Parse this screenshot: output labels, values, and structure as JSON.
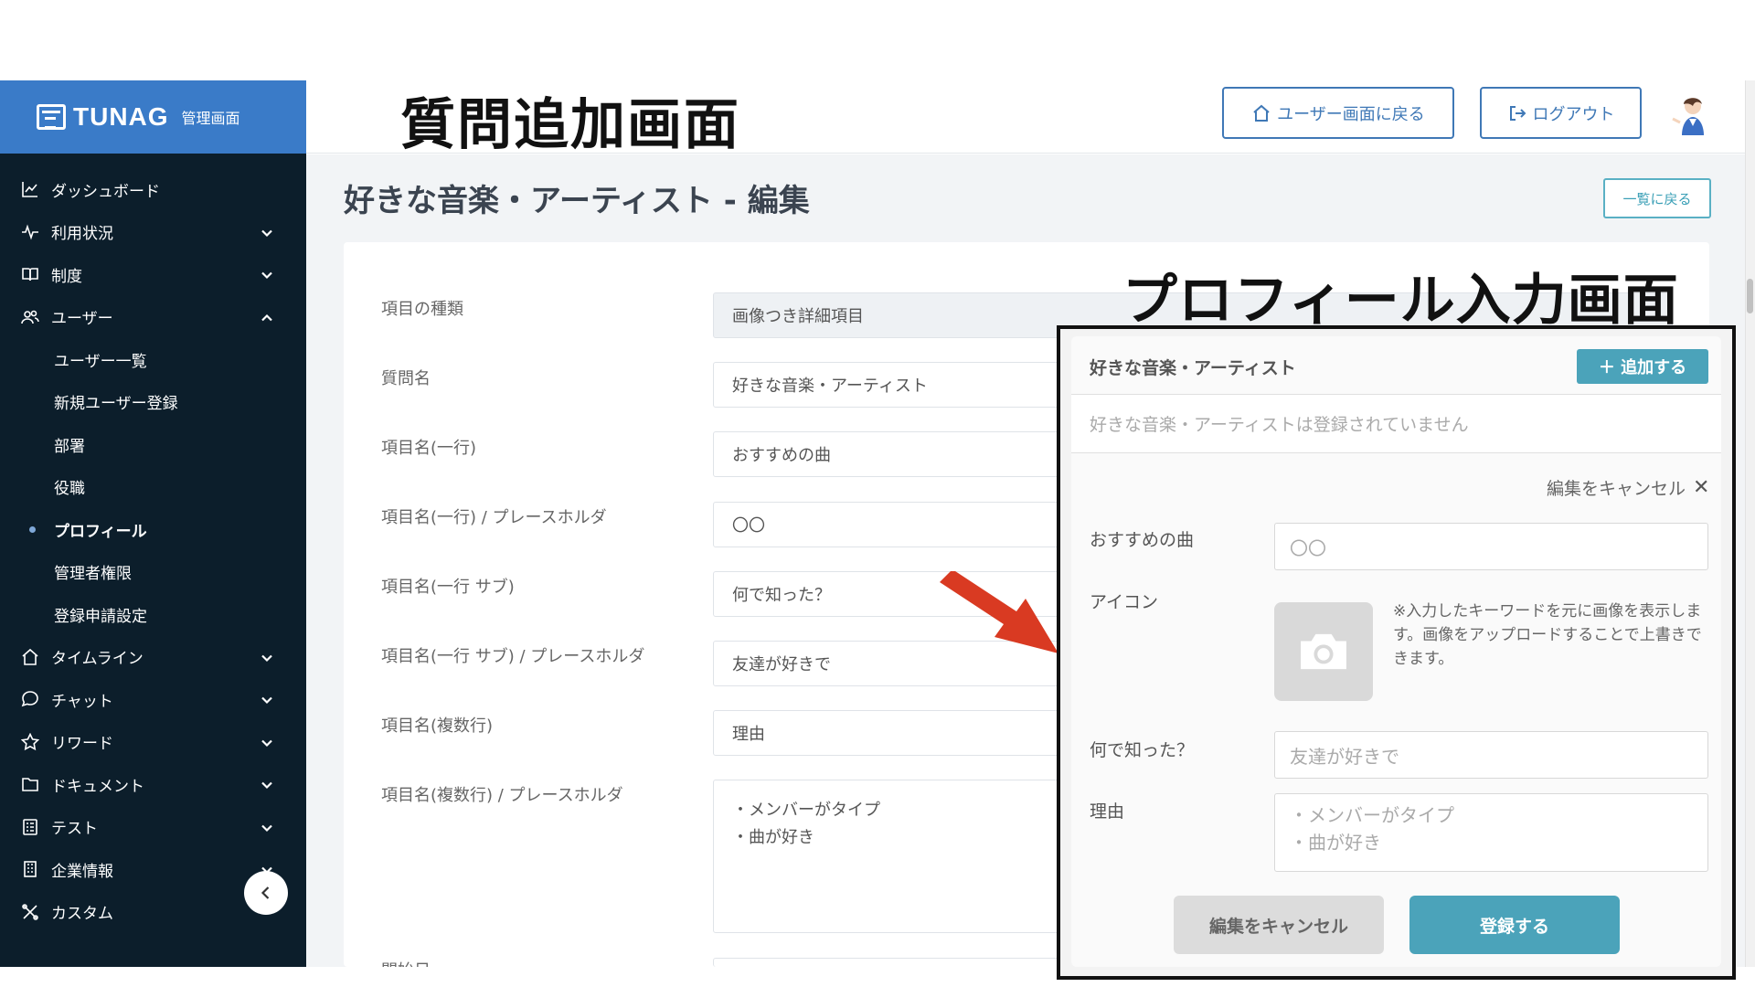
{
  "slide": {
    "title": "質問追加画面",
    "overlay_title": "プロフィール入力画面"
  },
  "brand": {
    "name": "TUNAG",
    "sub": "管理画面"
  },
  "header": {
    "user_screen_button": "ユーザー画面に戻る",
    "logout_button": "ログアウト"
  },
  "sidebar": {
    "items": [
      {
        "label": "ダッシュボード",
        "icon": "chart-icon"
      },
      {
        "label": "利用状況",
        "icon": "activity-icon"
      },
      {
        "label": "制度",
        "icon": "book-icon"
      },
      {
        "label": "ユーザー",
        "icon": "users-icon"
      }
    ],
    "user_sub": [
      "ユーザー一覧",
      "新規ユーザー登録",
      "部署",
      "役職",
      "プロフィール",
      "管理者権限",
      "登録申請設定"
    ],
    "items_after": [
      {
        "label": "タイムライン",
        "icon": "home-icon"
      },
      {
        "label": "チャット",
        "icon": "chat-icon"
      },
      {
        "label": "リワード",
        "icon": "star-icon"
      },
      {
        "label": "ドキュメント",
        "icon": "folder-icon"
      },
      {
        "label": "テスト",
        "icon": "list-icon"
      },
      {
        "label": "企業情報",
        "icon": "building-icon"
      },
      {
        "label": "カスタム",
        "icon": "tools-icon"
      }
    ],
    "active_sub": "プロフィール"
  },
  "page": {
    "title": "好きな音楽・アーティスト - 編集",
    "back_button": "一覧に戻る",
    "fields": [
      {
        "label": "項目の種類",
        "value": "画像つき詳細項目"
      },
      {
        "label": "質問名",
        "value": "好きな音楽・アーティスト"
      },
      {
        "label": "項目名(一行)",
        "value": "おすすめの曲"
      },
      {
        "label": "項目名(一行) / プレースホルダ",
        "value": "〇〇"
      },
      {
        "label": "項目名(一行 サブ)",
        "value": "何で知った？"
      },
      {
        "label": "項目名(一行 サブ) / プレースホルダ",
        "value": "友達が好きで"
      },
      {
        "label": "項目名(複数行)",
        "value": "理由"
      },
      {
        "label": "項目名(複数行) / プレースホルダ",
        "value_lines": [
          "・メンバーがタイプ",
          "・曲が好き"
        ]
      }
    ],
    "partial_label": "開始日"
  },
  "profile": {
    "section_title": "好きな音楽・アーティスト",
    "add_button": "＋ 追加する",
    "empty_text": "好きな音楽・アーティストは登録されていません",
    "cancel_link": "編集をキャンセル",
    "song_label": "おすすめの曲",
    "song_placeholder": "〇〇",
    "icon_label": "アイコン",
    "icon_note": "※入力したキーワードを元に画像を表示します。画像をアップロードすることで上書きできます。",
    "how_label": "何で知った？",
    "how_placeholder": "友達が好きで",
    "reason_label": "理由",
    "reason_lines": [
      "・メンバーがタイプ",
      "・曲が好き"
    ],
    "cancel_button": "編集をキャンセル",
    "submit_button": "登録する"
  },
  "colors": {
    "sidebar_bg": "#0c1e2b",
    "brand_bg": "#3a7bc8",
    "accent": "#4ba3ba",
    "header_button": "#3f78b6",
    "arrow": "#d93a22"
  }
}
